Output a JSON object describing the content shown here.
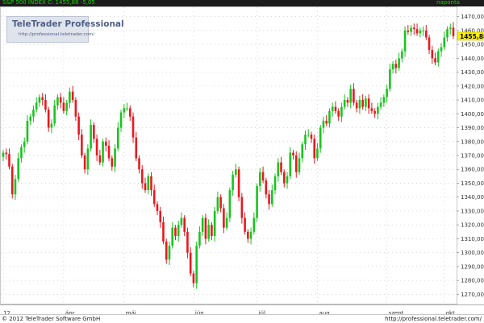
{
  "header": {
    "symbol_text": "S&P 500 INDEX C: 1455,88 -5,05",
    "period_label": "naponta"
  },
  "logo": {
    "name": "TeleTrader Professional",
    "url": "http://professional.teletrader.com/"
  },
  "footer": {
    "copyright": "© 2012 TeleTrader Software GmbH",
    "url": "http://professional.teletrader.com/"
  },
  "colors": {
    "up": "#19c41e",
    "down": "#e8191e",
    "price_label_bg": "#fff200",
    "axis_text": "#333333"
  },
  "chart_data": {
    "type": "candlestick",
    "series_name": "S&P 500 INDEX",
    "last_close": 1455.88,
    "change": -5.05,
    "ylim": [
      1265,
      1475
    ],
    "y_ticks": [
      1270,
      1280,
      1290,
      1300,
      1310,
      1320,
      1330,
      1340,
      1350,
      1360,
      1370,
      1380,
      1390,
      1400,
      1410,
      1420,
      1430,
      1440,
      1450,
      1460,
      1470
    ],
    "y_tick_labels": [
      "1270,00",
      "1280,00",
      "1290,00",
      "1300,00",
      "1310,00",
      "1320,00",
      "1330,00",
      "1340,00",
      "1350,00",
      "1360,00",
      "1370,00",
      "1380,00",
      "1390,00",
      "1400,00",
      "1410,00",
      "1420,00",
      "1430,00",
      "1440,00",
      "1450,00",
      "1460,00",
      "1470,00"
    ],
    "last_price_label": "1455,88",
    "x_labels": [
      {
        "text": "12",
        "index": 0
      },
      {
        "text": "ápr.",
        "index": 20
      },
      {
        "text": "máj.",
        "index": 40
      },
      {
        "text": "jún.",
        "index": 63
      },
      {
        "text": "júl.",
        "index": 84
      },
      {
        "text": "aug.",
        "index": 104
      },
      {
        "text": "szept.",
        "index": 127
      },
      {
        "text": "okt.",
        "index": 146
      }
    ],
    "candles_close": [
      1372,
      1371,
      1362,
      1342,
      1353,
      1368,
      1376,
      1380,
      1395,
      1398,
      1403,
      1408,
      1412,
      1410,
      1403,
      1390,
      1393,
      1406,
      1412,
      1408,
      1402,
      1408,
      1416,
      1410,
      1398,
      1385,
      1370,
      1360,
      1375,
      1392,
      1382,
      1370,
      1365,
      1380,
      1377,
      1368,
      1362,
      1375,
      1390,
      1401,
      1404,
      1404,
      1398,
      1383,
      1368,
      1360,
      1350,
      1345,
      1355,
      1345,
      1335,
      1330,
      1322,
      1308,
      1295,
      1305,
      1318,
      1312,
      1320,
      1325,
      1315,
      1300,
      1285,
      1278,
      1305,
      1315,
      1325,
      1310,
      1320,
      1312,
      1330,
      1340,
      1332,
      1318,
      1325,
      1345,
      1356,
      1360,
      1340,
      1325,
      1315,
      1310,
      1315,
      1325,
      1348,
      1358,
      1352,
      1342,
      1335,
      1345,
      1355,
      1365,
      1358,
      1350,
      1355,
      1372,
      1370,
      1358,
      1368,
      1378,
      1385,
      1385,
      1382,
      1368,
      1375,
      1390,
      1395,
      1393,
      1402,
      1405,
      1402,
      1398,
      1405,
      1410,
      1408,
      1418,
      1408,
      1404,
      1410,
      1405,
      1411,
      1404,
      1402,
      1400,
      1405,
      1408,
      1412,
      1418,
      1432,
      1436,
      1433,
      1440,
      1445,
      1460,
      1459,
      1462,
      1461,
      1458,
      1460,
      1460,
      1455,
      1446,
      1440,
      1437,
      1445,
      1448,
      1455,
      1461,
      1462,
      1455.88
    ]
  }
}
